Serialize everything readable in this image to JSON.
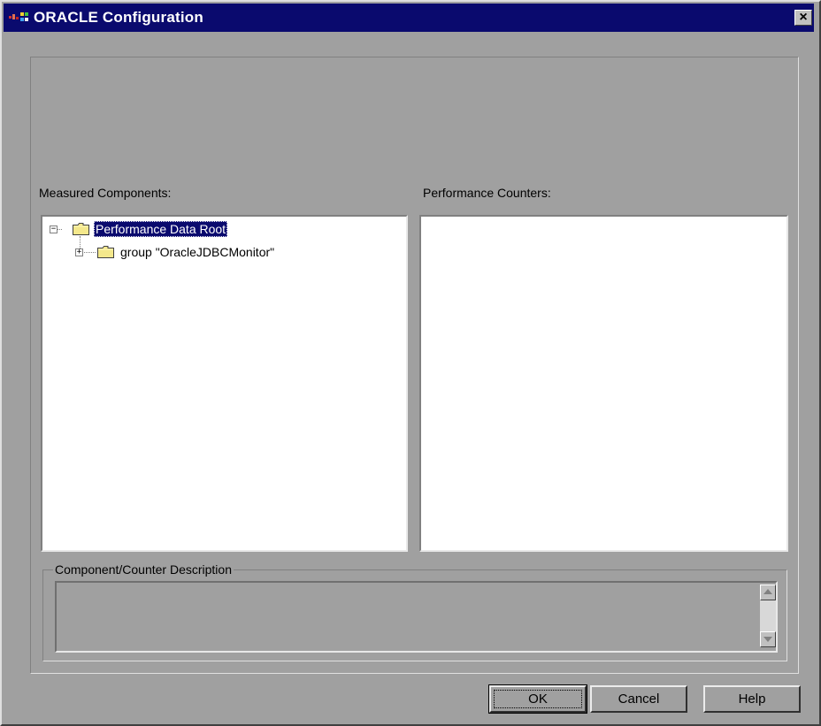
{
  "window": {
    "title": "ORACLE Configuration",
    "close_label": "×"
  },
  "measured_components": {
    "label": "Measured Components:",
    "tree": [
      {
        "label": "Performance Data Root",
        "expander": "−",
        "selected": true,
        "icon": "folder-icon"
      },
      {
        "label": "group \"OracleJDBCMonitor\"",
        "expander": "+",
        "selected": false,
        "icon": "folder-icon"
      }
    ]
  },
  "performance_counters": {
    "label": "Performance Counters:"
  },
  "description": {
    "legend": "Component/Counter Description",
    "text": ""
  },
  "buttons": {
    "ok": "OK",
    "cancel": "Cancel",
    "help": "Help"
  },
  "colors": {
    "title_bar": "#0a0a6e",
    "dialog_bg": "#a0a0a0",
    "selection": "#0a0a6e",
    "folder": "#f4e88c"
  }
}
